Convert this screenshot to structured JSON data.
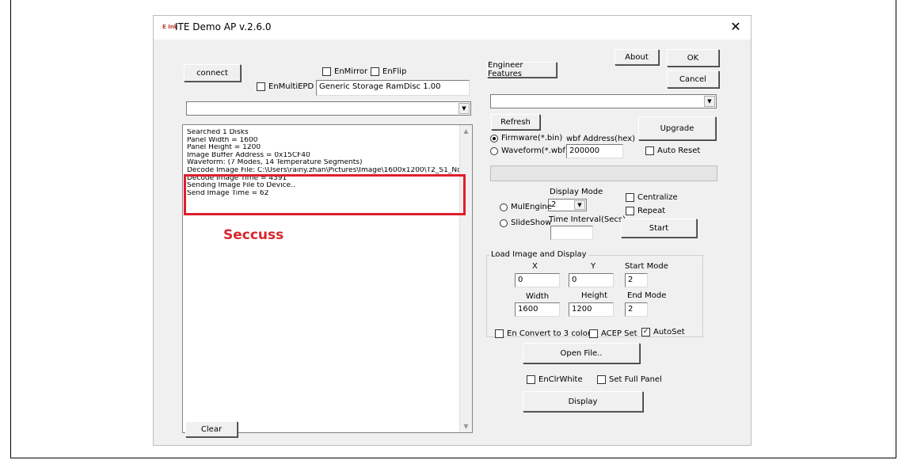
{
  "window": {
    "logo": "E Ink",
    "title": "ITE Demo AP v.2.6.0",
    "close_glyph": "✕"
  },
  "left": {
    "connect_label": "connect",
    "en_mirror_label": "EnMirror",
    "en_flip_label": "EnFlip",
    "en_multi_epd_label": "EnMultiEPD",
    "storage_value": "Generic Storage RamDisc 1.00",
    "device_select_value": "",
    "log_lines": [
      "Searched 1 Disks",
      "Panel Width = 1600",
      "Panel Height = 1200",
      "Image Buffer Address = 0x15CF40",
      "Waveform: (7 Modes, 14 Temperature Segments)",
      "Decode Image File: C:\\Users\\rainy.zhan\\Pictures\\Image\\1600x1200\\T2_S1_Nc",
      "Decode Image Time = 4391",
      "Sending Image File to Device..",
      "Send Image Time = 62"
    ],
    "annotation": "Seccuss",
    "clear_label": "Clear"
  },
  "right": {
    "about_label": "About",
    "ok_label": "OK",
    "cancel_label": "Cancel",
    "engineer_label": "Engineer Features",
    "select_value": "",
    "refresh_label": "Refresh",
    "upgrade_label": "Upgrade",
    "firmware_label": "Firmware(*.bin)",
    "waveform_label": "Waveform(*.wbf)",
    "wbf_address_label": "wbf Address(hex)",
    "wbf_address_value": "200000",
    "auto_reset_label": "Auto Reset",
    "display_mode_label": "Display Mode",
    "display_mode_value": "2",
    "mul_engine_label": "MulEngine",
    "slideshow_label": "SlideShow",
    "time_interval_label": "Time Interval(Secs)",
    "time_interval_value": "",
    "centralize_label": "Centralize",
    "repeat_label": "Repeat",
    "start_label": "Start",
    "load_group_title": "Load Image and Display",
    "x_label": "X",
    "y_label": "Y",
    "start_mode_label": "Start Mode",
    "x_value": "0",
    "y_value": "0",
    "start_mode_value": "2",
    "width_label": "Width",
    "height_label": "Height",
    "end_mode_label": "End Mode",
    "width_value": "1600",
    "height_value": "1200",
    "end_mode_value": "2",
    "en_convert_label": "En Convert to 3 color",
    "acep_label": "ACEP Set",
    "autoset_label": "AutoSet",
    "open_file_label": "Open File..",
    "en_clr_white_label": "EnClrWhite",
    "set_full_panel_label": "Set Full Panel",
    "display_label": "Display"
  },
  "colors": {
    "highlight": "#e01e2e",
    "annotation": "#d6262b"
  }
}
